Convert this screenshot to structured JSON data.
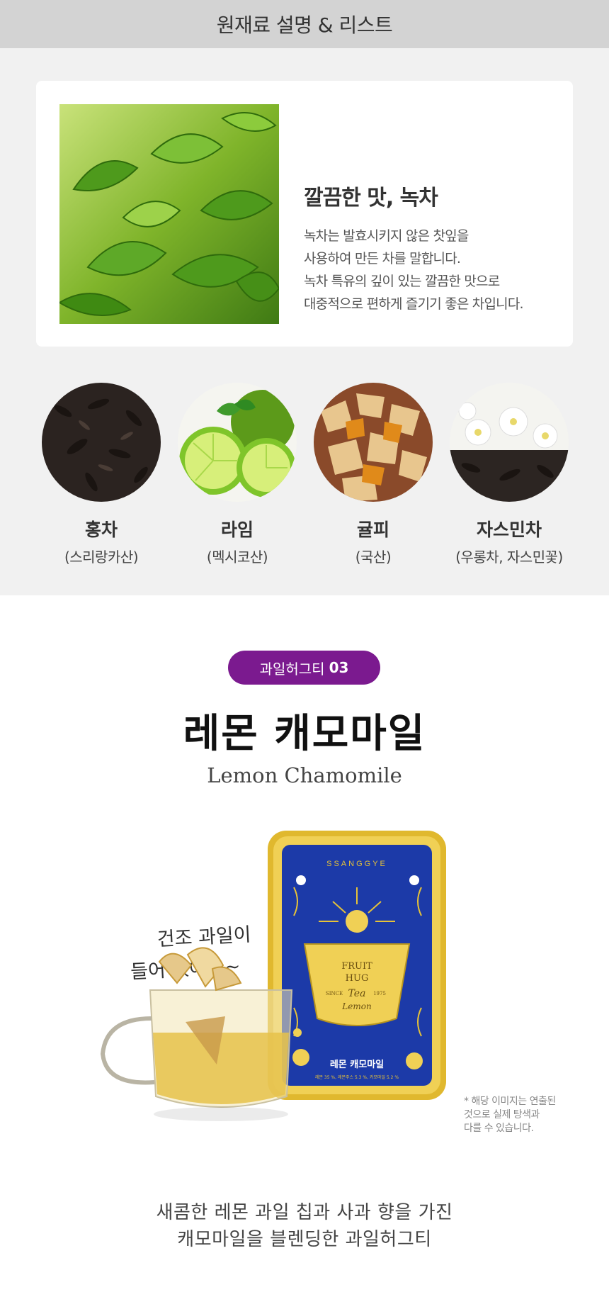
{
  "header": {
    "title": "원재료 설명 & 리스트"
  },
  "feature": {
    "title": "깔끔한 맛, 녹차",
    "lines": [
      "녹차는 발효시키지 않은 찻잎을",
      "사용하여 만든 차를 말합니다.",
      "녹차 특유의 깊이 있는 깔끔한 맛으로",
      "대중적으로 편하게 즐기기 좋은 차입니다."
    ]
  },
  "ingredients": [
    {
      "name": "홍차",
      "origin": "(스리랑카산)"
    },
    {
      "name": "라임",
      "origin": "(멕시코산)"
    },
    {
      "name": "귤피",
      "origin": "(국산)"
    },
    {
      "name": "자스민차",
      "origin": "(우롱차, 자스민꽃)"
    }
  ],
  "product": {
    "badge_text": "과일허그티",
    "badge_number": "03",
    "title_ko": "레몬 캐모마일",
    "title_en": "Lemon Chamomile",
    "handwriting": [
      "건조 과일이",
      "들어 있어요~"
    ],
    "tin": {
      "brand": "SSANGGYE",
      "cup_line1": "FRUIT",
      "cup_line2": "HUG",
      "since": "SINCE",
      "tea": "Tea",
      "year": "1975",
      "flavor": "Lemon",
      "label": "레몬 캐모마일",
      "ingredients_line": "레몬 35 %, 레몬주스 5.3 %, 카모마일 5.2 %"
    },
    "disclaimer": [
      "* 해당 이미지는 연출된",
      "것으로 실제 탕색과",
      "다를 수 있습니다."
    ],
    "description": [
      "새콤한 레몬 과일 칩과 사과 향을 가진",
      "캐모마일을 블렌딩한 과일허그티"
    ]
  },
  "colors": {
    "accent": "#7b1a8f",
    "tin_blue": "#1c3aa8",
    "tin_gold": "#e6c238"
  }
}
